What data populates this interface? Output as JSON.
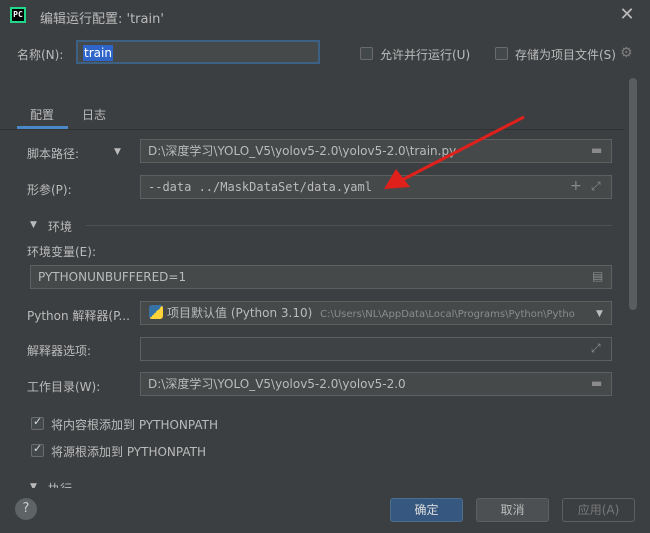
{
  "window": {
    "title": "编辑运行配置: 'train'",
    "close": "✕"
  },
  "name": {
    "label": "名称(N):",
    "value": "train"
  },
  "options": {
    "allow_parallel": "允许并行运行(U)",
    "store_as_project_file": "存储为项目文件(S)"
  },
  "tabs": [
    {
      "label": "配置",
      "active": true
    },
    {
      "label": "日志",
      "active": false
    }
  ],
  "config": {
    "script_path": {
      "label": "脚本路径:",
      "value": "D:\\深度学习\\YOLO_V5\\yolov5-2.0\\yolov5-2.0\\train.py"
    },
    "params": {
      "label": "形参(P):",
      "value": "--data ../MaskDataSet/data.yaml"
    },
    "env_section": "环境",
    "env_vars": {
      "label": "环境变量(E):",
      "value": "PYTHONUNBUFFERED=1"
    },
    "interpreter": {
      "label": "Python 解释器(P...",
      "value": "项目默认值 (Python 3.10)",
      "path": "C:\\Users\\NL\\AppData\\Local\\Programs\\Python\\Pytho"
    },
    "interp_options": {
      "label": "解释器选项:",
      "value": ""
    },
    "work_dir": {
      "label": "工作目录(W):",
      "value": "D:\\深度学习\\YOLO_V5\\yolov5-2.0\\yolov5-2.0"
    },
    "add_content_roots": "将内容根添加到 PYTHONPATH",
    "add_source_roots": "将源根添加到 PYTHONPATH",
    "exec_section": "执行"
  },
  "buttons": {
    "ok": "确定",
    "cancel": "取消",
    "apply": "应用(A)",
    "help": "?"
  },
  "colors": {
    "background": "#3c3f41",
    "field": "#45494a",
    "accent": "#4a88c7",
    "annotation_arrow": "#e0201b"
  }
}
